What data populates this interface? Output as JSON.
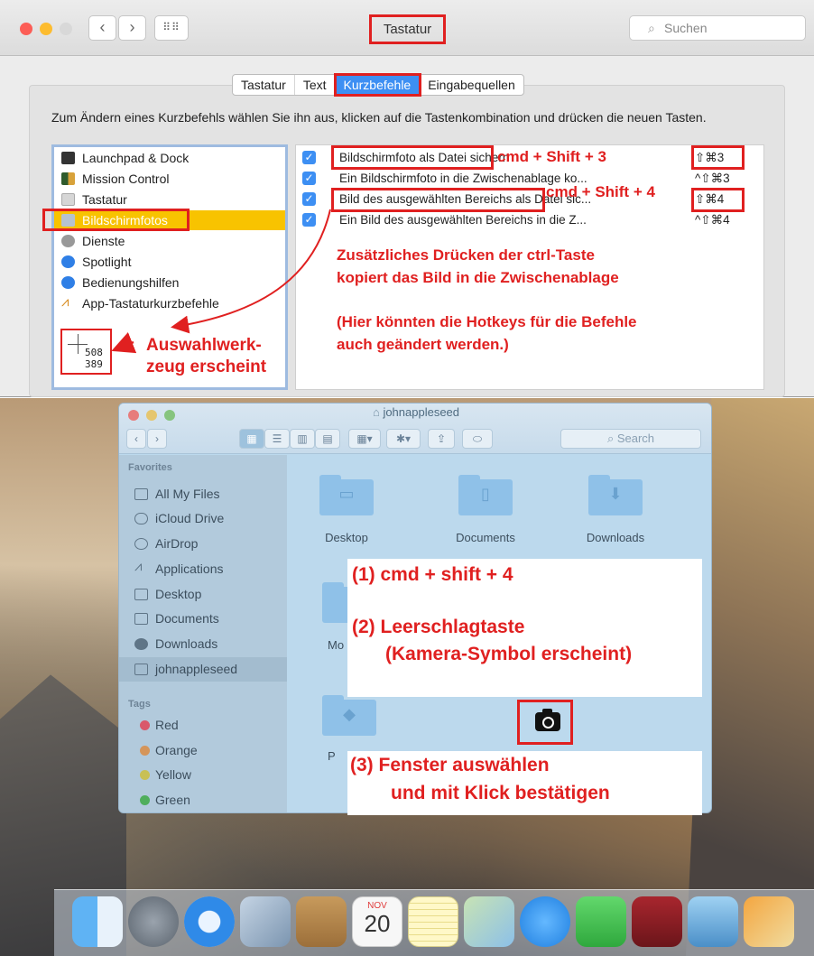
{
  "prefs": {
    "title": "Tastatur",
    "search_placeholder": "Suchen",
    "tabs": [
      "Tastatur",
      "Text",
      "Kurzbefehle",
      "Eingabequellen"
    ],
    "selected_tab": "Kurzbefehle",
    "description": "Zum Ändern eines Kurzbefehls wählen Sie ihn aus, klicken auf die Tastenkombination und drücken die neuen Tasten.",
    "categories": [
      {
        "label": "Launchpad & Dock",
        "icon": "launchpad-dock-icon",
        "color": "#333333"
      },
      {
        "label": "Mission Control",
        "icon": "mission-control-icon",
        "color": "#2f5b2c"
      },
      {
        "label": "Tastatur",
        "icon": "keyboard-icon",
        "color": "#cfcfcf"
      },
      {
        "label": "Bildschirmfotos",
        "icon": "screenshot-icon",
        "color": "#9aa8b8"
      },
      {
        "label": "Dienste",
        "icon": "gear-icon",
        "color": "#8a8a8a"
      },
      {
        "label": "Spotlight",
        "icon": "spotlight-icon",
        "color": "#2f7fe6"
      },
      {
        "label": "Bedienungshilfen",
        "icon": "accessibility-icon",
        "color": "#2f7fe6"
      },
      {
        "label": "App-Tastaturkurzbefehle",
        "icon": "app-shortcuts-icon",
        "color": "#d88a1c"
      }
    ],
    "selected_category": "Bildschirmfotos",
    "shortcuts": [
      {
        "label": "Bildschirmfoto als Datei sichern",
        "key": "⇧⌘3",
        "checked": true
      },
      {
        "label": "Ein Bildschirmfoto in die Zwischenablage ko...",
        "key": "^⇧⌘3",
        "checked": true
      },
      {
        "label": "Bild des ausgewählten Bereichs als Datei sic...",
        "key": "⇧⌘4",
        "checked": true
      },
      {
        "label": "Ein Bild des ausgewählten Bereichs in die Z...",
        "key": "^⇧⌘4",
        "checked": true
      }
    ],
    "cursor_x": "508",
    "cursor_y": "389",
    "annotations": {
      "cmd3": "cmd + Shift + 3",
      "cmd4": "cmd + Shift + 4",
      "ctrl1": "Zusätzliches Drücken der ctrl-Taste",
      "ctrl2": "kopiert das Bild in die Zwischenablage",
      "hotkeys1": "(Hier könnten die Hotkeys für die Befehle",
      "hotkeys2": "auch geändert werden.)",
      "tool1": "Auswahlwerk-",
      "tool2": "zeug erscheint"
    }
  },
  "finder": {
    "title": "johnappleseed",
    "search_placeholder": "Search",
    "favorites_header": "Favorites",
    "favorites": [
      {
        "label": "All My Files",
        "icon": "all-files-icon"
      },
      {
        "label": "iCloud Drive",
        "icon": "cloud-icon"
      },
      {
        "label": "AirDrop",
        "icon": "airdrop-icon"
      },
      {
        "label": "Applications",
        "icon": "applications-icon"
      },
      {
        "label": "Desktop",
        "icon": "desktop-icon"
      },
      {
        "label": "Documents",
        "icon": "documents-icon"
      },
      {
        "label": "Downloads",
        "icon": "downloads-icon"
      },
      {
        "label": "johnappleseed",
        "icon": "home-icon"
      }
    ],
    "selected_favorite": "johnappleseed",
    "tags_header": "Tags",
    "tags": [
      {
        "label": "Red",
        "color": "#d9586b"
      },
      {
        "label": "Orange",
        "color": "#d5955a"
      },
      {
        "label": "Yellow",
        "color": "#c8c055"
      },
      {
        "label": "Green",
        "color": "#4fae5c"
      }
    ],
    "folders": [
      {
        "label": "Desktop",
        "icon": "folder-desktop-icon"
      },
      {
        "label": "Documents",
        "icon": "folder-documents-icon"
      },
      {
        "label": "Downloads",
        "icon": "folder-downloads-icon"
      }
    ],
    "partial_labels": [
      "Mo",
      "P"
    ]
  },
  "notes": {
    "step1": "(1) cmd + shift + 4",
    "step2a": "(2) Leerschlagtaste",
    "step2b": "(Kamera-Symbol erscheint)",
    "step3a": "(3) Fenster auswählen",
    "step3b": "und mit Klick bestätigen"
  },
  "dock": {
    "calendar_month": "NOV",
    "calendar_day": "20",
    "apps": [
      "finder-icon",
      "launchpad-icon",
      "safari-icon",
      "mail-icon",
      "contacts-icon",
      "calendar-icon",
      "notes-icon",
      "maps-icon",
      "messages-icon",
      "facetime-icon",
      "photo-booth-icon",
      "iphoto-icon",
      "pages-icon"
    ]
  },
  "colors": {
    "annotation_red": "#e02020",
    "selection_blue": "#3d8ff3",
    "selection_yellow": "#f8c300"
  }
}
